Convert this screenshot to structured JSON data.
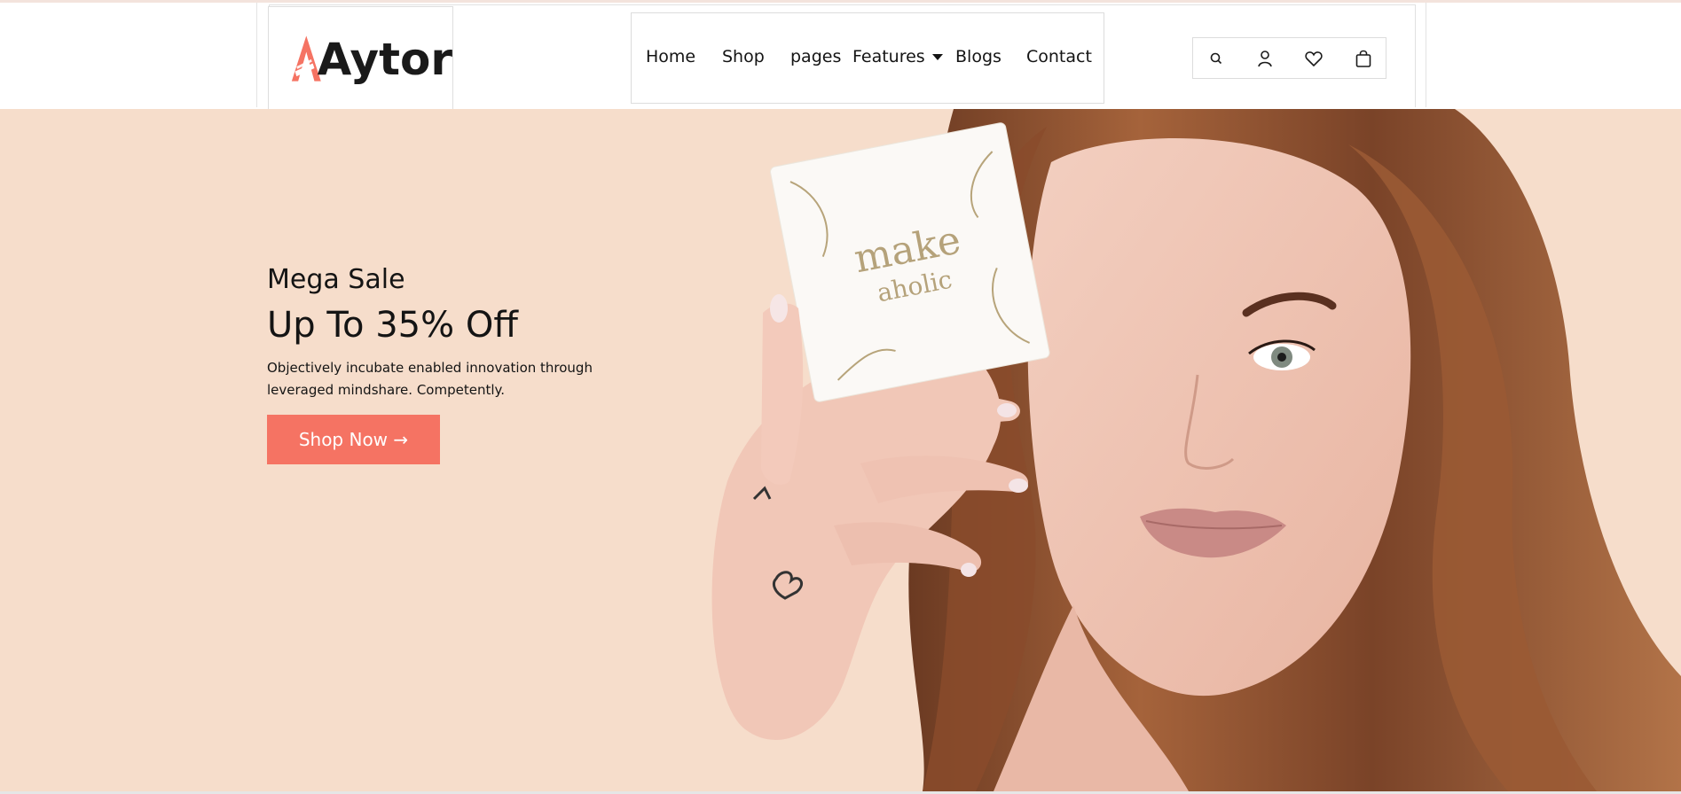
{
  "brand": {
    "name": "Aytor",
    "accent": "#f57363",
    "text_color": "#141414",
    "hero_background": "#f6ddcb"
  },
  "nav": {
    "items": [
      {
        "label": "Home"
      },
      {
        "label": "Shop"
      },
      {
        "label": "pages"
      },
      {
        "label": "Features",
        "has_dropdown": true
      },
      {
        "label": "Blogs"
      },
      {
        "label": "Contact"
      }
    ]
  },
  "header_icons": [
    {
      "icon": "search-icon"
    },
    {
      "icon": "user-icon"
    },
    {
      "icon": "heart-icon"
    },
    {
      "icon": "shopping-bag-icon"
    }
  ],
  "hero": {
    "eyebrow": "Mega Sale",
    "title": "Up To 35% Off",
    "description": "Objectively incubate enabled innovation through leveraged mindshare. Competently.",
    "button_label": "Shop Now →",
    "card_text_line1": "make",
    "card_text_line2": "aholic"
  }
}
